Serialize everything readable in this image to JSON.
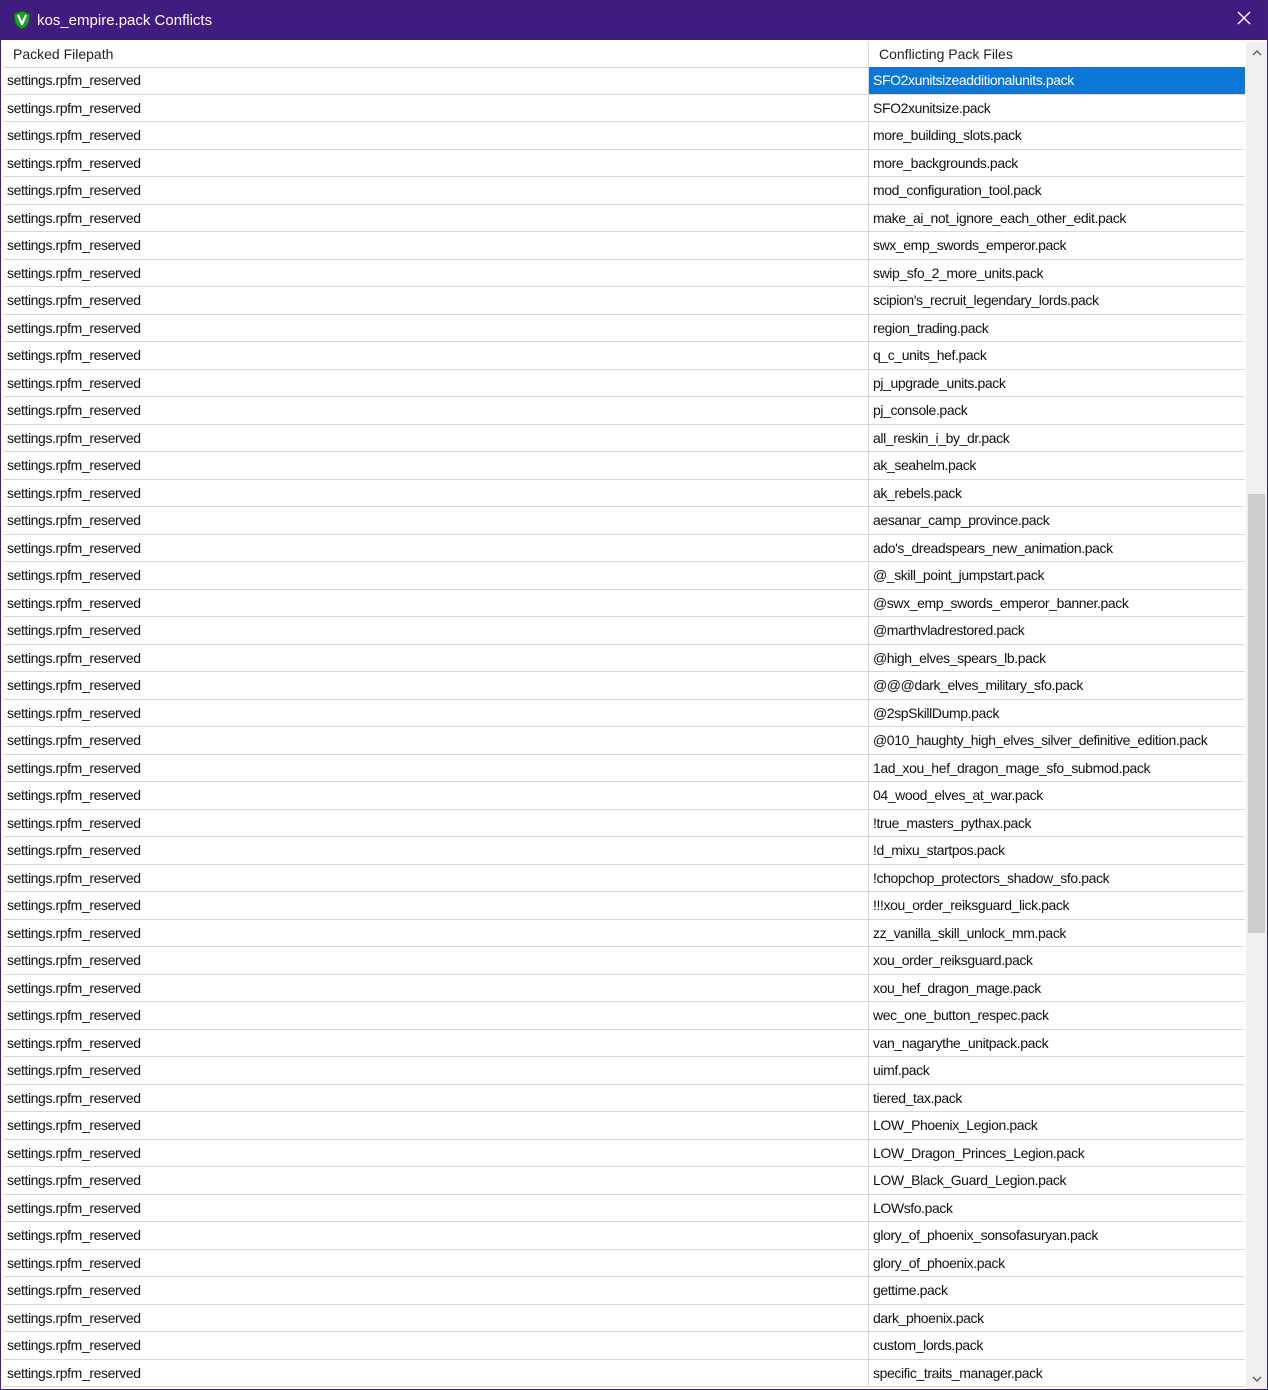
{
  "window": {
    "title": "kos_empire.pack Conflicts",
    "colors": {
      "titlebar": "#401c80",
      "selection": "#0b78d7",
      "icon": "#1f9e2c"
    },
    "icons": {
      "app": "app-logo-icon",
      "close": "close-icon"
    }
  },
  "table": {
    "headers": {
      "col1": "Packed Filepath",
      "col2": "Conflicting Pack Files"
    },
    "selected_row": 0,
    "rows": [
      {
        "path": "settings.rpfm_reserved",
        "pack": "SFO2xunitsizeadditionalunits.pack"
      },
      {
        "path": "settings.rpfm_reserved",
        "pack": "SFO2xunitsize.pack"
      },
      {
        "path": "settings.rpfm_reserved",
        "pack": "more_building_slots.pack"
      },
      {
        "path": "settings.rpfm_reserved",
        "pack": "more_backgrounds.pack"
      },
      {
        "path": "settings.rpfm_reserved",
        "pack": "mod_configuration_tool.pack"
      },
      {
        "path": "settings.rpfm_reserved",
        "pack": "make_ai_not_ignore_each_other_edit.pack"
      },
      {
        "path": "settings.rpfm_reserved",
        "pack": "swx_emp_swords_emperor.pack"
      },
      {
        "path": "settings.rpfm_reserved",
        "pack": "swip_sfo_2_more_units.pack"
      },
      {
        "path": "settings.rpfm_reserved",
        "pack": "scipion's_recruit_legendary_lords.pack"
      },
      {
        "path": "settings.rpfm_reserved",
        "pack": "region_trading.pack"
      },
      {
        "path": "settings.rpfm_reserved",
        "pack": "q_c_units_hef.pack"
      },
      {
        "path": "settings.rpfm_reserved",
        "pack": "pj_upgrade_units.pack"
      },
      {
        "path": "settings.rpfm_reserved",
        "pack": "pj_console.pack"
      },
      {
        "path": "settings.rpfm_reserved",
        "pack": "all_reskin_i_by_dr.pack"
      },
      {
        "path": "settings.rpfm_reserved",
        "pack": "ak_seahelm.pack"
      },
      {
        "path": "settings.rpfm_reserved",
        "pack": "ak_rebels.pack"
      },
      {
        "path": "settings.rpfm_reserved",
        "pack": "aesanar_camp_province.pack"
      },
      {
        "path": "settings.rpfm_reserved",
        "pack": "ado's_dreadspears_new_animation.pack"
      },
      {
        "path": "settings.rpfm_reserved",
        "pack": "@_skill_point_jumpstart.pack"
      },
      {
        "path": "settings.rpfm_reserved",
        "pack": "@swx_emp_swords_emperor_banner.pack"
      },
      {
        "path": "settings.rpfm_reserved",
        "pack": "@marthvladrestored.pack"
      },
      {
        "path": "settings.rpfm_reserved",
        "pack": "@high_elves_spears_lb.pack"
      },
      {
        "path": "settings.rpfm_reserved",
        "pack": "@@@dark_elves_military_sfo.pack"
      },
      {
        "path": "settings.rpfm_reserved",
        "pack": "@2spSkillDump.pack"
      },
      {
        "path": "settings.rpfm_reserved",
        "pack": "@010_haughty_high_elves_silver_definitive_edition.pack"
      },
      {
        "path": "settings.rpfm_reserved",
        "pack": "1ad_xou_hef_dragon_mage_sfo_submod.pack"
      },
      {
        "path": "settings.rpfm_reserved",
        "pack": "04_wood_elves_at_war.pack"
      },
      {
        "path": "settings.rpfm_reserved",
        "pack": "!true_masters_pythax.pack"
      },
      {
        "path": "settings.rpfm_reserved",
        "pack": "!d_mixu_startpos.pack"
      },
      {
        "path": "settings.rpfm_reserved",
        "pack": "!chopchop_protectors_shadow_sfo.pack"
      },
      {
        "path": "settings.rpfm_reserved",
        "pack": "!!!xou_order_reiksguard_lick.pack"
      },
      {
        "path": "settings.rpfm_reserved",
        "pack": "zz_vanilla_skill_unlock_mm.pack"
      },
      {
        "path": "settings.rpfm_reserved",
        "pack": "xou_order_reiksguard.pack"
      },
      {
        "path": "settings.rpfm_reserved",
        "pack": "xou_hef_dragon_mage.pack"
      },
      {
        "path": "settings.rpfm_reserved",
        "pack": "wec_one_button_respec.pack"
      },
      {
        "path": "settings.rpfm_reserved",
        "pack": "van_nagarythe_unitpack.pack"
      },
      {
        "path": "settings.rpfm_reserved",
        "pack": "uimf.pack"
      },
      {
        "path": "settings.rpfm_reserved",
        "pack": "tiered_tax.pack"
      },
      {
        "path": "settings.rpfm_reserved",
        "pack": "LOW_Phoenix_Legion.pack"
      },
      {
        "path": "settings.rpfm_reserved",
        "pack": "LOW_Dragon_Princes_Legion.pack"
      },
      {
        "path": "settings.rpfm_reserved",
        "pack": "LOW_Black_Guard_Legion.pack"
      },
      {
        "path": "settings.rpfm_reserved",
        "pack": "LOWsfo.pack"
      },
      {
        "path": "settings.rpfm_reserved",
        "pack": "glory_of_phoenix_sonsofasuryan.pack"
      },
      {
        "path": "settings.rpfm_reserved",
        "pack": "glory_of_phoenix.pack"
      },
      {
        "path": "settings.rpfm_reserved",
        "pack": "gettime.pack"
      },
      {
        "path": "settings.rpfm_reserved",
        "pack": "dark_phoenix.pack"
      },
      {
        "path": "settings.rpfm_reserved",
        "pack": "custom_lords.pack"
      },
      {
        "path": "settings.rpfm_reserved",
        "pack": "specific_traits_manager.pack"
      }
    ]
  }
}
